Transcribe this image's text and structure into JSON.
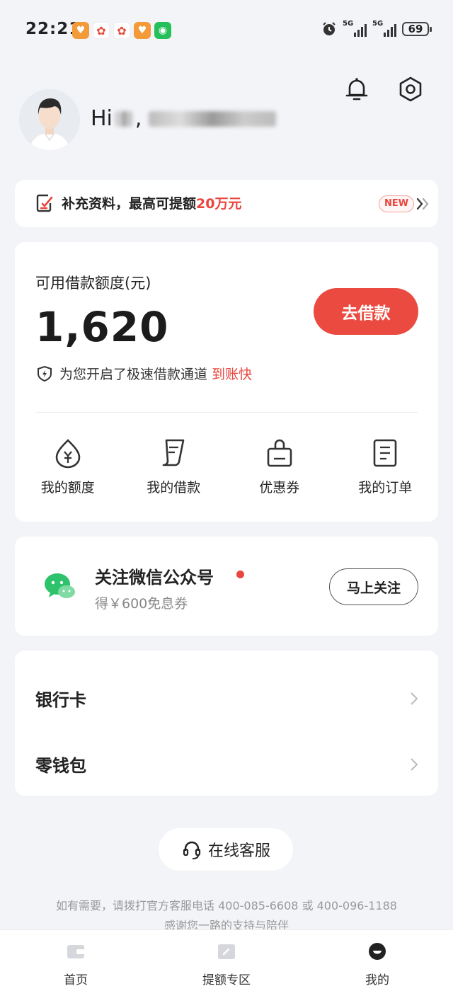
{
  "status_bar": {
    "time": "22:21",
    "network1": "5G",
    "network2": "5G",
    "battery": "69"
  },
  "header": {
    "greeting": "Hi"
  },
  "banner": {
    "text_prefix": "补充资料，最高可提额",
    "amount": "20万元",
    "badge": "NEW"
  },
  "credit": {
    "label": "可用借款额度(元)",
    "amount": "1,620",
    "borrow_button": "去借款",
    "fast_text": "为您开启了极速借款通道",
    "fast_highlight": "到账快"
  },
  "quick_actions": [
    {
      "label": "我的额度",
      "icon": "credit-drop-icon"
    },
    {
      "label": "我的借款",
      "icon": "loan-document-icon"
    },
    {
      "label": "优惠券",
      "icon": "coupon-bag-icon"
    },
    {
      "label": "我的订单",
      "icon": "order-list-icon"
    }
  ],
  "wechat": {
    "title": "关注微信公众号",
    "subtitle": "得￥600免息券",
    "follow_button": "马上关注"
  },
  "menu": [
    {
      "label": "银行卡"
    },
    {
      "label": "零钱包"
    }
  ],
  "service": {
    "button": "在线客服",
    "hotline_line1": "如有需要，请拨打官方客服电话 400-085-6608 或 400-096-1188",
    "hotline_line2": "感谢您一路的支持与陪伴"
  },
  "bottom_nav": [
    {
      "label": "首页"
    },
    {
      "label": "提额专区"
    },
    {
      "label": "我的"
    }
  ],
  "colors": {
    "accent": "#ea4a3f",
    "background": "#f3f4f8",
    "wechat_green": "#2dc26b"
  }
}
